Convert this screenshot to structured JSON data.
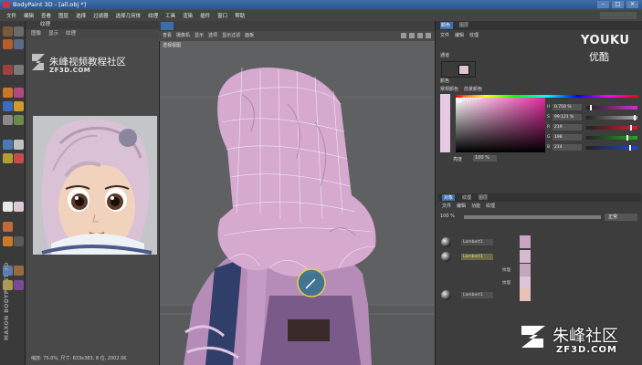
{
  "window": {
    "title": "BodyPaint 3D - [all.obj *]",
    "controls": [
      "–",
      "□",
      "×"
    ]
  },
  "menu": [
    "文件",
    "编辑",
    "查看",
    "图层",
    "选择",
    "过滤器",
    "选择几何体",
    "纹理",
    "工具",
    "渲染",
    "插件",
    "窗口",
    "帮助"
  ],
  "left_panel": {
    "header": "纹理",
    "tabs": [
      "图像",
      "显示",
      "纹理"
    ],
    "logo_cn": "朱峰视频教程社区",
    "logo_url": "ZF3D.COM",
    "brand_vertical": "MAXON BODYPAINT 3D",
    "status": "缩放: 75.0%, 尺寸: 633x383, 8 位, 2002.0K"
  },
  "viewport": {
    "menu": [
      "查看",
      "摄像机",
      "显示",
      "选项",
      "显示过滤",
      "面板"
    ],
    "label": "透视视图"
  },
  "right_panel": {
    "tabs": [
      "颜色",
      "图层"
    ],
    "menu": [
      "文件",
      "编辑",
      "纹理"
    ],
    "channel_label": "通道",
    "color_label": "颜色",
    "color_mode_options": [
      "常规颜色",
      "前景颜色"
    ],
    "sliders": [
      {
        "label": "H",
        "value": "0.750 %",
        "color": "#cc33cc",
        "level": 0.08
      },
      {
        "label": "S",
        "value": "99.121 %",
        "color": "#aaaaaa",
        "level": 0.93
      },
      {
        "label": "R",
        "value": "219",
        "color": "#cc2222",
        "level": 0.86
      },
      {
        "label": "G",
        "value": "198",
        "color": "#22aa22",
        "level": 0.78
      },
      {
        "label": "B",
        "value": "214",
        "color": "#2244cc",
        "level": 0.84
      }
    ],
    "hex_label": "亮度",
    "hex_value": "100 %",
    "rgb_hex": "#DBC6D6",
    "layers_tabs": [
      "对象",
      "纹理",
      "图层"
    ],
    "layers_menu": [
      "文件",
      "编辑",
      "功能",
      "纹理"
    ],
    "blend_mode": "正常",
    "opacity": "100 %",
    "layers": [
      {
        "name": "Lambert1",
        "tag": "",
        "thumb": "#c9a4c3"
      },
      {
        "name": "Lambert1",
        "tag": "",
        "thumb": "#d6b8cf"
      },
      {
        "name": "",
        "tag": "纹理",
        "thumb": "#c4a6be"
      },
      {
        "name": "",
        "tag": "纹理",
        "thumb": "#ddc6d8"
      },
      {
        "name": "Lambert1",
        "tag": "",
        "thumb": "#e7c2b6"
      }
    ]
  },
  "watermarks": {
    "youku": "YOUKU",
    "youku_cn": "优酷",
    "site_cn": "朱峰社区",
    "site_url": "ZF3D.COM"
  },
  "colors": {
    "accent": "#3e6ea8",
    "hair": "#d6a9cf",
    "viewport_bg": "#5f6062",
    "panel_bg": "#3d3d3d"
  }
}
